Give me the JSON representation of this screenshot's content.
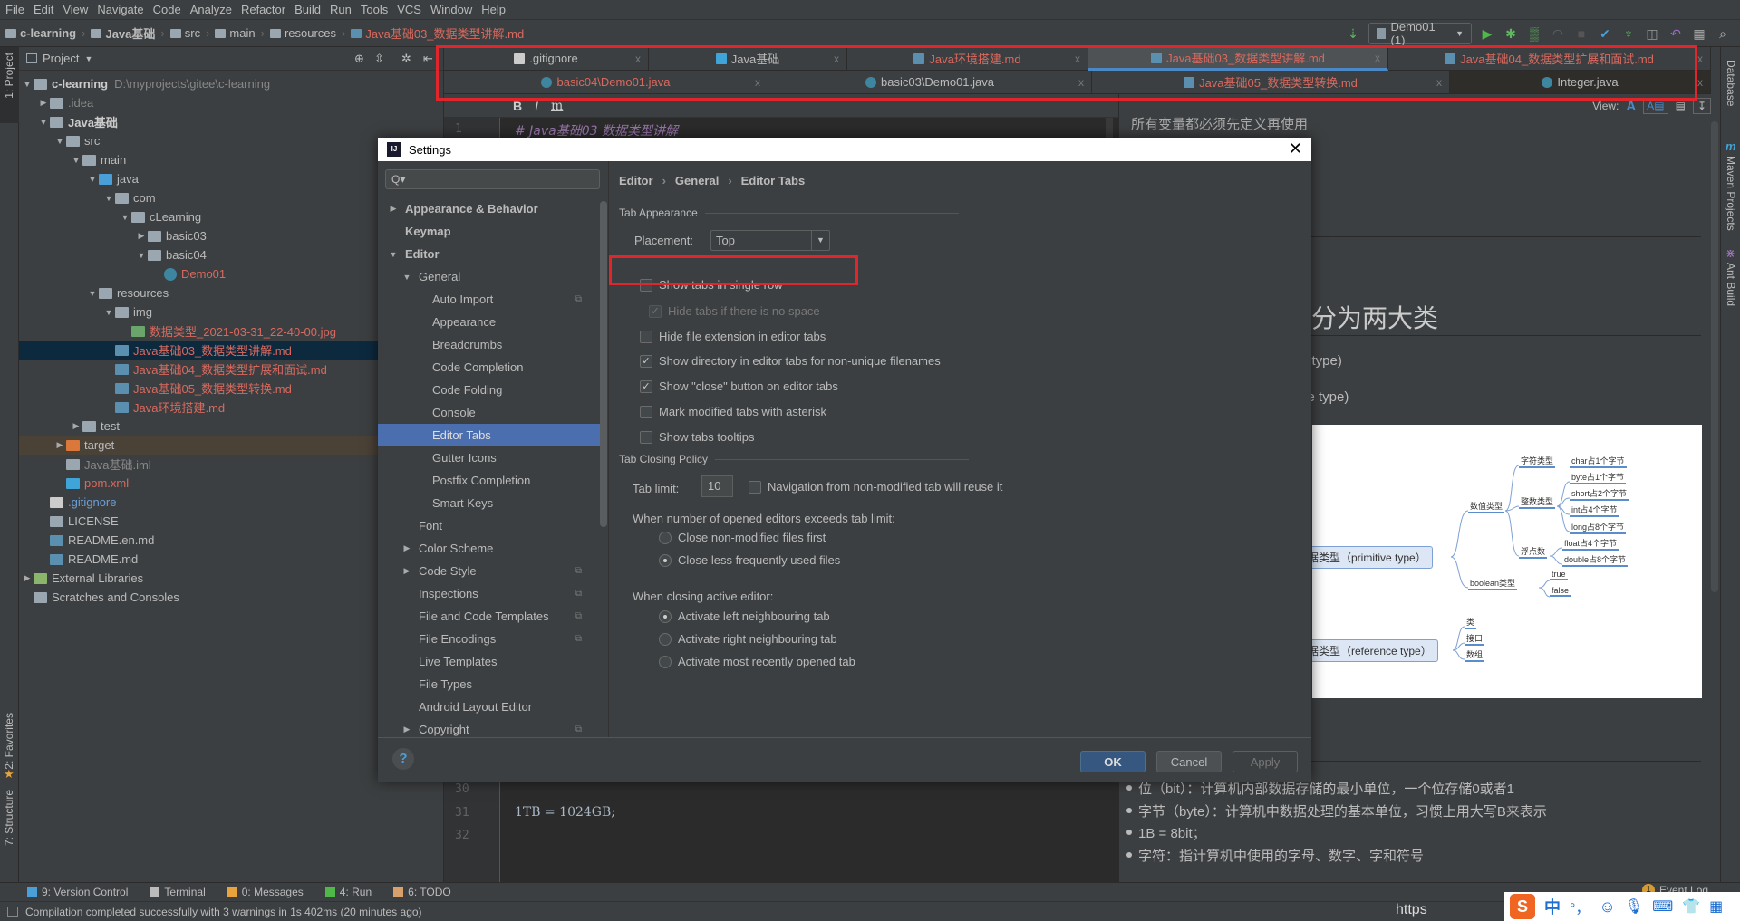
{
  "menu": [
    "File",
    "Edit",
    "View",
    "Navigate",
    "Code",
    "Analyze",
    "Refactor",
    "Build",
    "Run",
    "Tools",
    "VCS",
    "Window",
    "Help"
  ],
  "breadcrumb": [
    "c-learning",
    "Java基础",
    "src",
    "main",
    "resources",
    "Java基础03_数据类型讲解.md"
  ],
  "toolbar": {
    "run_config": "Demo01 (1)",
    "icons": [
      "build-icon",
      "run-icon",
      "debug-icon",
      "coverage-icon",
      "profile-icon",
      "stop-icon",
      "vcs-update-icon",
      "vcs-commit-icon",
      "history-icon",
      "revert-icon",
      "project-structure-icon",
      "search-icon"
    ]
  },
  "left_stripe": {
    "project": "1: Project",
    "favorites": "2: Favorites",
    "structure": "7: Structure"
  },
  "right_stripe": {
    "database": "Database",
    "maven": "Maven Projects",
    "ant": "Ant Build"
  },
  "project_panel": {
    "title": "Project",
    "tree": [
      {
        "label": "c-learning",
        "path": "D:\\myprojects\\gitee\\c-learning",
        "level": 0,
        "arrow": "down",
        "icon": "module",
        "style": "bold"
      },
      {
        "label": ".idea",
        "level": 1,
        "arrow": "right",
        "icon": "folder",
        "style": "dim"
      },
      {
        "label": "Java基础",
        "level": 1,
        "arrow": "down",
        "icon": "module",
        "style": "bold"
      },
      {
        "label": "src",
        "level": 2,
        "arrow": "down",
        "icon": "folder"
      },
      {
        "label": "main",
        "level": 3,
        "arrow": "down",
        "icon": "folder"
      },
      {
        "label": "java",
        "level": 4,
        "arrow": "down",
        "icon": "source-folder"
      },
      {
        "label": "com",
        "level": 5,
        "arrow": "down",
        "icon": "package"
      },
      {
        "label": "cLearning",
        "level": 6,
        "arrow": "down",
        "icon": "package"
      },
      {
        "label": "basic03",
        "level": 7,
        "arrow": "right",
        "icon": "package"
      },
      {
        "label": "basic04",
        "level": 7,
        "arrow": "down",
        "icon": "package"
      },
      {
        "label": "Demo01",
        "level": 8,
        "arrow": "",
        "icon": "class",
        "style": "red"
      },
      {
        "label": "resources",
        "level": 4,
        "arrow": "down",
        "icon": "resources-folder"
      },
      {
        "label": "img",
        "level": 5,
        "arrow": "down",
        "icon": "package"
      },
      {
        "label": "数据类型_2021-03-31_22-40-00.jpg",
        "level": 6,
        "arrow": "",
        "icon": "image",
        "style": "red"
      },
      {
        "label": "Java基础03_数据类型讲解.md",
        "level": 5,
        "arrow": "",
        "icon": "markdown",
        "style": "red",
        "selected": true
      },
      {
        "label": "Java基础04_数据类型扩展和面试.md",
        "level": 5,
        "arrow": "",
        "icon": "markdown",
        "style": "red"
      },
      {
        "label": "Java基础05_数据类型转换.md",
        "level": 5,
        "arrow": "",
        "icon": "markdown",
        "style": "red"
      },
      {
        "label": "Java环境搭建.md",
        "level": 5,
        "arrow": "",
        "icon": "markdown",
        "style": "red"
      },
      {
        "label": "test",
        "level": 3,
        "arrow": "right",
        "icon": "folder"
      },
      {
        "label": "target",
        "level": 2,
        "arrow": "right",
        "icon": "excluded-folder",
        "highlight": true
      },
      {
        "label": "Java基础.iml",
        "level": 2,
        "arrow": "",
        "icon": "iml",
        "style": "dim"
      },
      {
        "label": "pom.xml",
        "level": 2,
        "arrow": "",
        "icon": "maven",
        "style": "red"
      },
      {
        "label": ".gitignore",
        "level": 1,
        "arrow": "",
        "icon": "git",
        "style": "blue"
      },
      {
        "label": "LICENSE",
        "level": 1,
        "arrow": "",
        "icon": "text"
      },
      {
        "label": "README.en.md",
        "level": 1,
        "arrow": "",
        "icon": "markdown"
      },
      {
        "label": "README.md",
        "level": 1,
        "arrow": "",
        "icon": "markdown"
      },
      {
        "label": "External Libraries",
        "level": 0,
        "arrow": "right",
        "icon": "libraries"
      },
      {
        "label": "Scratches and Consoles",
        "level": 0,
        "arrow": "",
        "icon": "scratches"
      }
    ]
  },
  "editor_tabs": {
    "row1": [
      {
        "label": ".gitignore",
        "icon": "git",
        "color": "#bbbbbb"
      },
      {
        "label": "Java基础",
        "icon": "maven",
        "color": "#bbbbbb"
      },
      {
        "label": "Java环境搭建.md",
        "icon": "markdown",
        "color": "#d9695f"
      },
      {
        "label": "Java基础03_数据类型讲解.md",
        "icon": "markdown",
        "color": "#d9695f",
        "active": true
      },
      {
        "label": "Java基础04_数据类型扩展和面试.md",
        "icon": "markdown",
        "color": "#d9695f"
      }
    ],
    "row2": [
      {
        "label": "basic04\\Demo01.java",
        "icon": "class",
        "color": "#d9695f"
      },
      {
        "label": "basic03\\Demo01.java",
        "icon": "class",
        "color": "#bbbbbb"
      },
      {
        "label": "Java基础05_数据类型转换.md",
        "icon": "markdown",
        "color": "#d9695f"
      },
      {
        "label": "Integer.java",
        "icon": "class-readonly",
        "color": "#bbbbbb",
        "dark": true
      }
    ],
    "close_glyph": "x"
  },
  "md_toolbar": {
    "bold": "B",
    "italic": "I",
    "code": "m"
  },
  "editor": {
    "lines": [
      {
        "num": "1",
        "text": "# Java基础03 数据类型讲解"
      },
      {
        "num": "30",
        "text": ""
      },
      {
        "num": "31",
        "text": "1TB = 1024GB;"
      },
      {
        "num": "32",
        "text": ""
      }
    ]
  },
  "preview": {
    "view_label": "View:",
    "intro": "所有变量都必须先定义再使用",
    "heading": "分为两大类",
    "item1": "e type)",
    "item2": "ce type)",
    "mindmap": {
      "primitive": "基本数据类型（primitive type）",
      "reference": "引用数据类型（reference type）",
      "numeric": "数值类型",
      "char_type": "字符类型",
      "char": "char占1个字节",
      "int_type": "整数类型",
      "byte": "byte占1个字节",
      "short": "short占2个字节",
      "int": "int占4个字节",
      "long": "long占8个字节",
      "float_type": "浮点数",
      "float": "float占4个字节",
      "double": "double占8个字节",
      "boolean": "boolean类型",
      "true": "true",
      "false": "false",
      "class": "类",
      "interface": "接口",
      "array": "数组"
    },
    "bullets": [
      "位（bit）：计算机内部数据存储的最小单位，一个位存储0或者1",
      "字节（byte）：计算机中数据处理的基本单位，习惯上用大写B来表示",
      "1B = 8bit；",
      "字符：指计算机中使用的字母、数字、字和符号"
    ]
  },
  "dialog": {
    "title": "Settings",
    "search_placeholder": "Q▾",
    "tree": [
      {
        "label": "Appearance & Behavior",
        "level": 0,
        "arrow": "right",
        "bold": true
      },
      {
        "label": "Keymap",
        "level": 0,
        "arrow": "",
        "bold": true
      },
      {
        "label": "Editor",
        "level": 0,
        "arrow": "down",
        "bold": true
      },
      {
        "label": "General",
        "level": 1,
        "arrow": "down"
      },
      {
        "label": "Auto Import",
        "level": 2,
        "copy": true
      },
      {
        "label": "Appearance",
        "level": 2
      },
      {
        "label": "Breadcrumbs",
        "level": 2
      },
      {
        "label": "Code Completion",
        "level": 2
      },
      {
        "label": "Code Folding",
        "level": 2
      },
      {
        "label": "Console",
        "level": 2
      },
      {
        "label": "Editor Tabs",
        "level": 2,
        "selected": true
      },
      {
        "label": "Gutter Icons",
        "level": 2
      },
      {
        "label": "Postfix Completion",
        "level": 2
      },
      {
        "label": "Smart Keys",
        "level": 2
      },
      {
        "label": "Font",
        "level": 1
      },
      {
        "label": "Color Scheme",
        "level": 1,
        "arrow": "right"
      },
      {
        "label": "Code Style",
        "level": 1,
        "arrow": "right",
        "copy": true
      },
      {
        "label": "Inspections",
        "level": 1,
        "copy": true
      },
      {
        "label": "File and Code Templates",
        "level": 1,
        "copy": true
      },
      {
        "label": "File Encodings",
        "level": 1,
        "copy": true
      },
      {
        "label": "Live Templates",
        "level": 1
      },
      {
        "label": "File Types",
        "level": 1
      },
      {
        "label": "Android Layout Editor",
        "level": 1
      },
      {
        "label": "Copyright",
        "level": 1,
        "arrow": "right",
        "copy": true
      }
    ],
    "breadcrumb": [
      "Editor",
      "General",
      "Editor Tabs"
    ],
    "tab_appearance": {
      "section": "Tab Appearance",
      "placement_label": "Placement:",
      "placement_value": "Top",
      "options": [
        {
          "label": "Show tabs in single row",
          "checked": false
        },
        {
          "label": "Hide tabs if there is no space",
          "checked": true,
          "disabled": true,
          "indent": true
        },
        {
          "label": "Hide file extension in editor tabs",
          "checked": false
        },
        {
          "label": "Show directory in editor tabs for non-unique filenames",
          "checked": true
        },
        {
          "label": "Show \"close\" button on editor tabs",
          "checked": true
        },
        {
          "label": "Mark modified tabs with asterisk",
          "checked": false
        },
        {
          "label": "Show tabs tooltips",
          "checked": false
        }
      ]
    },
    "tab_closing": {
      "section": "Tab Closing Policy",
      "tab_limit_label": "Tab limit:",
      "tab_limit_value": "10",
      "navigation_reuse": {
        "label": "Navigation from non-modified tab will reuse it",
        "checked": false
      },
      "exceeds_label": "When number of opened editors exceeds tab limit:",
      "exceeds_options": [
        {
          "label": "Close non-modified files first",
          "selected": false
        },
        {
          "label": "Close less frequently used files",
          "selected": true
        }
      ],
      "closing_label": "When closing active editor:",
      "closing_options": [
        {
          "label": "Activate left neighbouring tab",
          "selected": true
        },
        {
          "label": "Activate right neighbouring tab",
          "selected": false
        },
        {
          "label": "Activate most recently opened tab",
          "selected": false
        }
      ]
    },
    "buttons": {
      "ok": "OK",
      "cancel": "Cancel",
      "apply": "Apply",
      "help": "?"
    }
  },
  "bottom_tools": [
    "9: Version Control",
    "Terminal",
    "0: Messages",
    "4: Run",
    "6: TODO"
  ],
  "event_log": {
    "label": "Event Log",
    "count": "1"
  },
  "status": "Compilation completed successfully with 3 warnings in 1s 402ms (20 minutes ago)",
  "watermark": "https",
  "ime": {
    "lang": "中",
    "punct": "°，"
  },
  "colors": {
    "accent": "#4b6eaf",
    "highlight_box": "#e0262a",
    "modified_file": "#d9695f",
    "background": "#3c3f41",
    "editor_bg": "#2b2b2b"
  }
}
